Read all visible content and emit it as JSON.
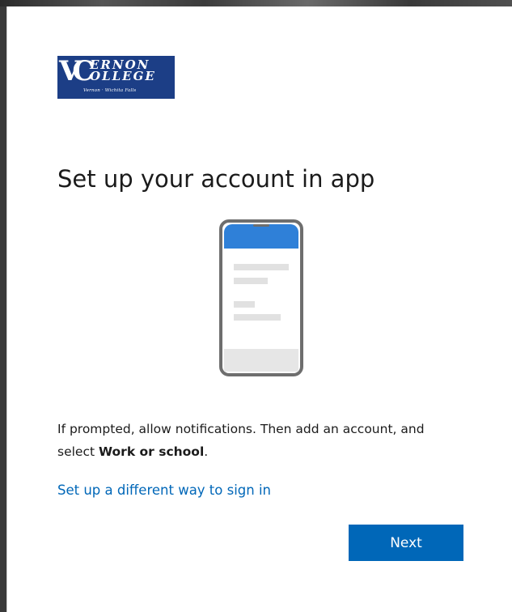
{
  "logo": {
    "initials": "VC",
    "line1": "ERNON",
    "line2": "OLLEGE",
    "subtitle": "Vernon · Wichita Falls",
    "background": "#1c3e86"
  },
  "page": {
    "title": "Set up your account in app",
    "description_prefix": "If prompted, allow notifications. Then add an account, and select ",
    "description_emphasis": "Work or school",
    "description_suffix": ".",
    "alternate_link": "Set up a different way to sign in",
    "next_button": "Next"
  },
  "illustration": {
    "icon": "smartphone-icon",
    "frame_color": "#6e6e6e",
    "header_color": "#2f80d8"
  },
  "colors": {
    "accent": "#0067b8",
    "text": "#1b1b1b",
    "card": "#ffffff"
  }
}
